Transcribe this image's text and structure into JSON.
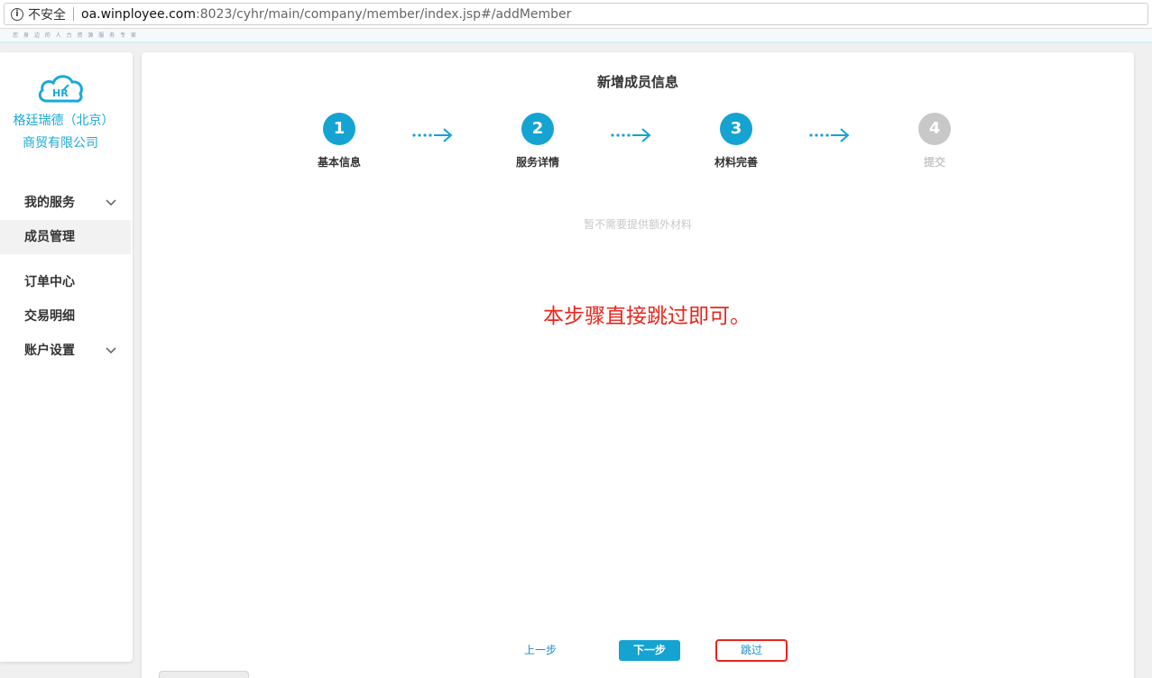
{
  "browser": {
    "security_label": "不安全",
    "url_host": "oa.winployee.com",
    "url_path": ":8023/cyhr/main/company/member/index.jsp#/addMember"
  },
  "header": {
    "slogan": "您 身 边 的 人 力 资 源 服 务 专 家"
  },
  "sidebar": {
    "logo_text": "HR",
    "company_name": "格廷瑞德（北京）商贸有限公司",
    "items": [
      {
        "label": "我的服务",
        "has_chevron": true
      },
      {
        "label": "成员管理",
        "active": true
      },
      {
        "label": "订单中心"
      },
      {
        "label": "交易明细"
      },
      {
        "label": "账户设置",
        "has_chevron": true
      }
    ]
  },
  "main": {
    "title": "新增成员信息",
    "steps": [
      {
        "number": "1",
        "label": "基本信息",
        "state": "done"
      },
      {
        "number": "2",
        "label": "服务详情",
        "state": "done"
      },
      {
        "number": "3",
        "label": "材料完善",
        "state": "current"
      },
      {
        "number": "4",
        "label": "提交",
        "state": "pending"
      }
    ],
    "no_material_text": "暂不需要提供额外材料",
    "annotation": "本步骤直接跳过即可。",
    "buttons": {
      "prev": "上一步",
      "next": "下一步",
      "skip": "跳过"
    }
  },
  "colors": {
    "accent": "#15a3d2",
    "annotation_red": "#e8261d",
    "disabled": "#c8c8c8"
  }
}
